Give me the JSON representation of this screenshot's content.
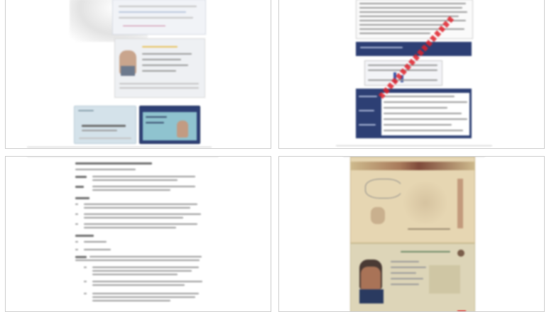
{
  "thumbnails": [
    {
      "id": "doc-1",
      "kind": "passport-and-id-cards",
      "selected": false
    },
    {
      "id": "doc-2",
      "kind": "report-with-tables",
      "watermark_color": "#e0202a",
      "selected": false
    },
    {
      "id": "doc-3",
      "kind": "text-document",
      "selected": false
    },
    {
      "id": "doc-4",
      "kind": "passport-scan",
      "selected": false
    }
  ],
  "colors": {
    "border": "#cfcfcf",
    "navy": "#2d3f74",
    "passport_tan": "#e2cfa3",
    "watermark_red": "#e0202a"
  }
}
